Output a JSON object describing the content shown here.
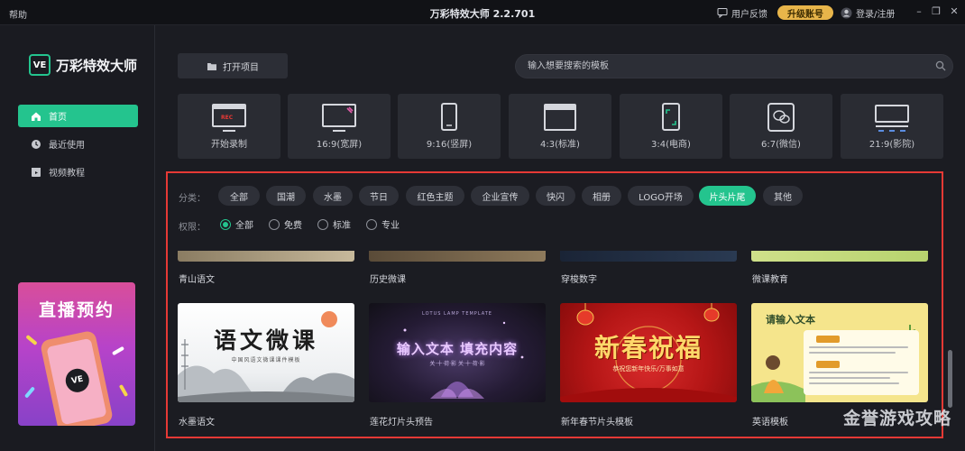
{
  "titlebar": {
    "help": "帮助",
    "title": "万彩特效大师 2.2.701",
    "feedback": "用户反馈",
    "upgrade": "升级账号",
    "login": "登录/注册"
  },
  "sidebar": {
    "logo_mark": "VE",
    "logo_text": "万彩特效大师",
    "items": [
      {
        "label": "首页",
        "icon": "home-icon",
        "active": true
      },
      {
        "label": "最近使用",
        "icon": "clock-icon",
        "active": false
      },
      {
        "label": "视频教程",
        "icon": "video-tutorial-icon",
        "active": false
      }
    ],
    "banner": {
      "title": "直播预约",
      "mark": "VE"
    }
  },
  "toolbar": {
    "open_project": "打开项目",
    "search_placeholder": "输入想要搜索的模板"
  },
  "ratios": [
    {
      "label": "开始录制",
      "icon": "record-screen-icon",
      "badge": "REC"
    },
    {
      "label": "16:9(宽屏)",
      "icon": "widescreen-icon"
    },
    {
      "label": "9:16(竖屏)",
      "icon": "portrait-phone-icon"
    },
    {
      "label": "4:3(标准)",
      "icon": "standard-window-icon"
    },
    {
      "label": "3:4(电商)",
      "icon": "ecommerce-phone-icon"
    },
    {
      "label": "6:7(微信)",
      "icon": "wechat-icon"
    },
    {
      "label": "21:9(影院)",
      "icon": "cinema-icon"
    }
  ],
  "filters": {
    "category_label": "分类：",
    "categories": [
      "全部",
      "国潮",
      "水墨",
      "节日",
      "红色主题",
      "企业宣传",
      "快闪",
      "相册",
      "LOGO开场",
      "片头片尾",
      "其他"
    ],
    "active_category": "片头片尾",
    "permission_label": "权限：",
    "permissions": [
      "全部",
      "免费",
      "标准",
      "专业"
    ],
    "active_permission": "全部"
  },
  "templates_row1": [
    "青山语文",
    "历史微课",
    "穿梭数字",
    "微课教育"
  ],
  "templates_row2": [
    {
      "label": "水墨语文",
      "title": "语文微课",
      "subtitle": "中国风语文微课课件模板"
    },
    {
      "label": "莲花灯片头预告",
      "top": "LOTUS LAMP TEMPLATE",
      "title": "输入文本 填充内容",
      "subtitle": "关·十·荷·影   关·十·荷·影"
    },
    {
      "label": "新年春节片头模板",
      "title": "新春祝福",
      "subtitle": "恭祝您新年快乐/万事如意"
    },
    {
      "label": "英语模板",
      "title": "请输入文本"
    }
  ],
  "watermark": "金誉游戏攻略",
  "colors": {
    "accent": "#24c48e",
    "upgrade": "#e8b54a",
    "highlight_border": "#e53935",
    "background": "#1b1c22"
  }
}
